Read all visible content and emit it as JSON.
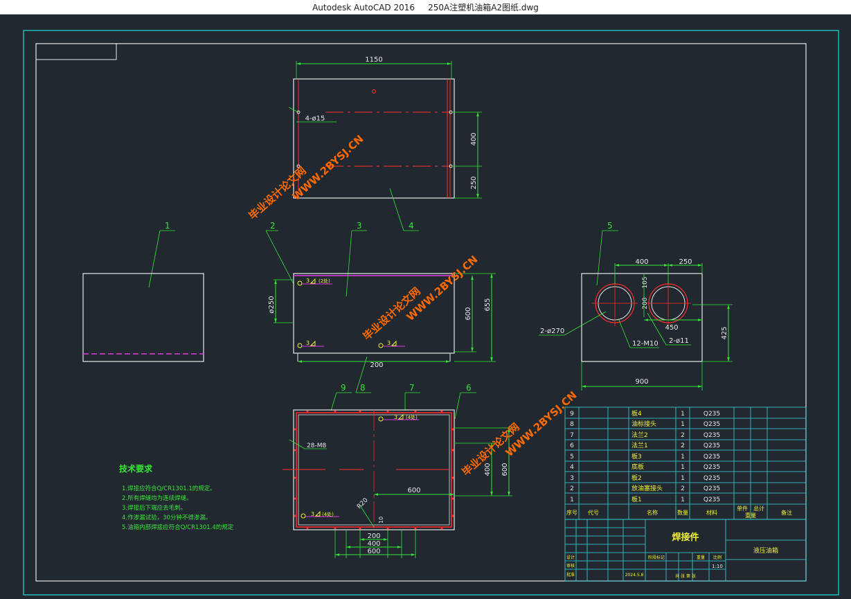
{
  "window": {
    "app_name": "Autodesk AutoCAD 2016",
    "file_name": "250A注塑机油箱A2图纸.dwg"
  },
  "colors": {
    "background": "#212830",
    "frame_outer": "#18c9c9",
    "white_lines": "#e8e8e8",
    "dims": "#35e635",
    "red": "#ff2d2d",
    "magenta": "#e13ce1",
    "yellow": "#f0f030",
    "watermark": "#ff6a00",
    "table": "#3ad6e0"
  },
  "top_view": {
    "dim_width": "1150",
    "dim_400": "400",
    "dim_250": "250",
    "hole_note": "4-ø15"
  },
  "balloons": [
    "1",
    "2",
    "3",
    "4",
    "5",
    "6",
    "7",
    "8",
    "9"
  ],
  "front_view": {
    "dim_dia250": "ø250",
    "dim_600": "600",
    "dim_655": "655",
    "dim_200": "200",
    "weld_1": "3",
    "weld_1_count": "(2处)",
    "weld_2": "3",
    "weld_3": "3"
  },
  "side_view": {
    "dim_400": "400",
    "dim_250": "250",
    "dim_105": "105",
    "dim_200": "200",
    "dim_450": "450",
    "dim_425": "425",
    "dim_900": "900",
    "note_holes_big": "2-ø270",
    "note_m10": "12-M10",
    "note_holes_small": "2-ø11"
  },
  "bottom_view": {
    "weld_a": "3",
    "weld_a_count": "(4处)",
    "weld_b": "3",
    "weld_b_count": "(4处)",
    "note_m8": "28-M8",
    "note_r20": "R20",
    "dim_10": "10",
    "dim_600_h": "600",
    "dim_400_v": "400",
    "dim_600_v": "600",
    "dim_200": "200",
    "dim_400": "400",
    "dim_600_b": "600"
  },
  "tech_requirements": {
    "title": "技术要求",
    "lines": [
      "1.焊接应符合Q/CR1301.1的规定。",
      "2.所有焊缝均为连续焊缝。",
      "3.焊接后下端应去毛刺。",
      "4.作渗漏试验，30分钟不得渗漏。",
      "5.油箱内部焊接应符合Q/CR1301.4的规定"
    ]
  },
  "parts_table": {
    "rows": [
      {
        "no": "9",
        "name": "板4",
        "qty": "1",
        "material": "Q235"
      },
      {
        "no": "8",
        "name": "油标接头",
        "qty": "1",
        "material": "Q235"
      },
      {
        "no": "7",
        "name": "法兰2",
        "qty": "2",
        "material": "Q235"
      },
      {
        "no": "6",
        "name": "法兰1",
        "qty": "2",
        "material": "Q235"
      },
      {
        "no": "5",
        "name": "板3",
        "qty": "1",
        "material": "Q235"
      },
      {
        "no": "4",
        "name": "底板",
        "qty": "1",
        "material": "Q235"
      },
      {
        "no": "3",
        "name": "板2",
        "qty": "1",
        "material": "Q235"
      },
      {
        "no": "2",
        "name": "放油塞接头",
        "qty": "2",
        "material": "Q235"
      },
      {
        "no": "1",
        "name": "板1",
        "qty": "1",
        "material": "Q235"
      }
    ],
    "header": [
      "序号",
      "代号",
      "名称",
      "数量",
      "材料",
      "单件",
      "总计",
      "重量",
      "备注"
    ]
  },
  "title_block": {
    "drawing_title": "焊接件",
    "part_name": "液压油箱",
    "scale": "1:10",
    "design": "设计",
    "check": "审核",
    "approve": "批准",
    "date": "2024.5.8",
    "stage_label": "阶段标记",
    "weight_label": "重量",
    "scale_label": "比例",
    "sheet_label": "共  张  第  张"
  },
  "watermarks": [
    "毕业设计论文网",
    "WWW.2BYSJ.CN"
  ]
}
